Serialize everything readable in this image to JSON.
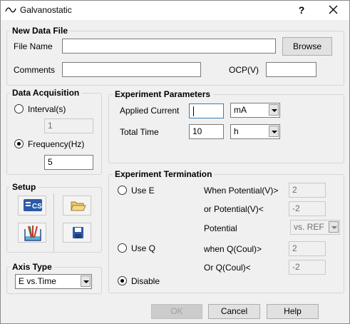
{
  "window": {
    "title": "Galvanostatic",
    "help": "?"
  },
  "new_data_file": {
    "title": "New Data File",
    "file_name_label": "File Name",
    "file_name_value": "",
    "browse_label": "Browse",
    "comments_label": "Comments",
    "comments_value": "",
    "ocp_label": "OCP(V)",
    "ocp_value": ""
  },
  "data_acquisition": {
    "title": "Data Acquisition",
    "interval_label": "Interval(s)",
    "interval_value": "1",
    "frequency_label": "Frequency(Hz)",
    "frequency_value": "5",
    "selected": "frequency"
  },
  "experiment_parameters": {
    "title": "Experiment Parameters",
    "applied_current_label": "Applied Current",
    "applied_current_value": "",
    "applied_current_unit": "mA",
    "total_time_label": "Total Time",
    "total_time_value": "10",
    "total_time_unit": "h"
  },
  "setup": {
    "title": "Setup"
  },
  "axis_type": {
    "title": "Axis Type",
    "value": "E vs.Time"
  },
  "experiment_termination": {
    "title": "Experiment Termination",
    "use_e_label": "Use E",
    "when_potential_label": "When Potential(V)>",
    "when_potential_value": "2",
    "or_potential_label": "or Potential(V)<",
    "or_potential_value": "-2",
    "potential_label": "Potential",
    "potential_ref": "vs. REF",
    "use_q_label": "Use Q",
    "when_q_label": "when Q(Coul)>",
    "when_q_value": "2",
    "or_q_label": "Or Q(Coul)<",
    "or_q_value": "-2",
    "disable_label": "Disable",
    "selected": "disable"
  },
  "footer": {
    "ok_label": "OK",
    "cancel_label": "Cancel",
    "help_label": "Help"
  },
  "icons": [
    "galvanostatic-wave-icon",
    "close-icon",
    "cs-instrument-icon",
    "electrode-icon",
    "open-folder-icon",
    "save-disk-icon"
  ],
  "colors": {
    "accent": "#3c7fb1",
    "cs_icon": "#2b5aa8"
  }
}
